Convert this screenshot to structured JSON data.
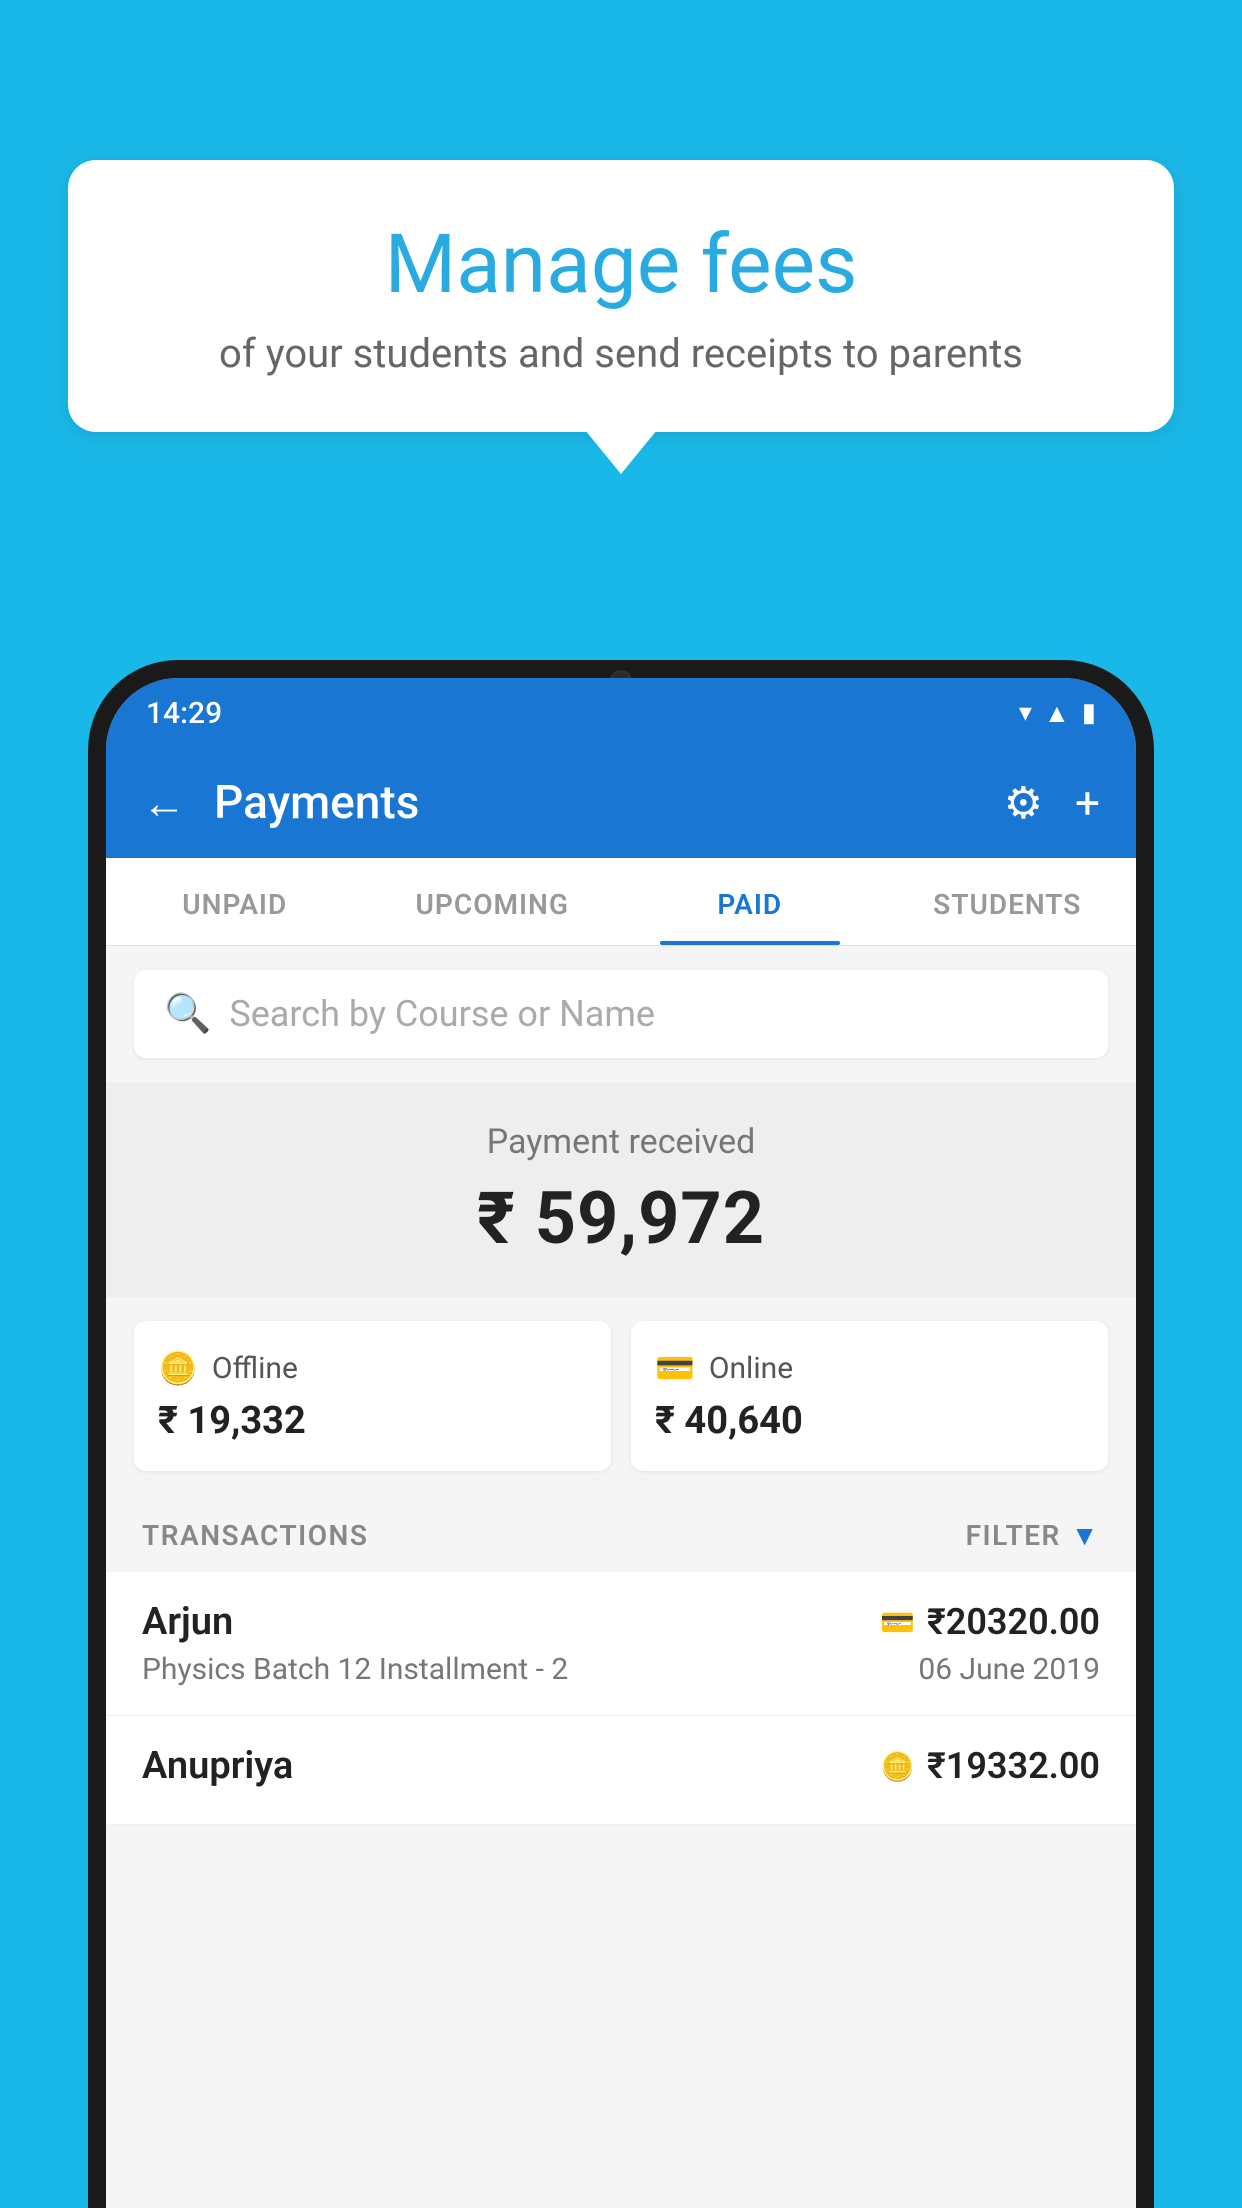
{
  "background_color": "#1ab8e8",
  "bubble": {
    "title": "Manage fees",
    "subtitle": "of your students and send receipts to parents"
  },
  "phone": {
    "status_bar": {
      "time": "14:29",
      "icons": [
        "wifi",
        "signal",
        "battery"
      ]
    },
    "app_bar": {
      "title": "Payments",
      "back_label": "←",
      "settings_label": "⚙",
      "add_label": "+"
    },
    "tabs": [
      {
        "label": "UNPAID",
        "active": false
      },
      {
        "label": "UPCOMING",
        "active": false
      },
      {
        "label": "PAID",
        "active": true
      },
      {
        "label": "STUDENTS",
        "active": false
      }
    ],
    "search": {
      "placeholder": "Search by Course or Name"
    },
    "payment": {
      "label": "Payment received",
      "amount": "₹ 59,972",
      "offline": {
        "label": "Offline",
        "amount": "₹ 19,332"
      },
      "online": {
        "label": "Online",
        "amount": "₹ 40,640"
      }
    },
    "transactions_label": "TRANSACTIONS",
    "filter_label": "FILTER",
    "transactions": [
      {
        "name": "Arjun",
        "mode_icon": "card",
        "amount": "₹20320.00",
        "course": "Physics Batch 12 Installment - 2",
        "date": "06 June 2019"
      },
      {
        "name": "Anupriya",
        "mode_icon": "cash",
        "amount": "₹19332.00",
        "course": "",
        "date": ""
      }
    ]
  }
}
